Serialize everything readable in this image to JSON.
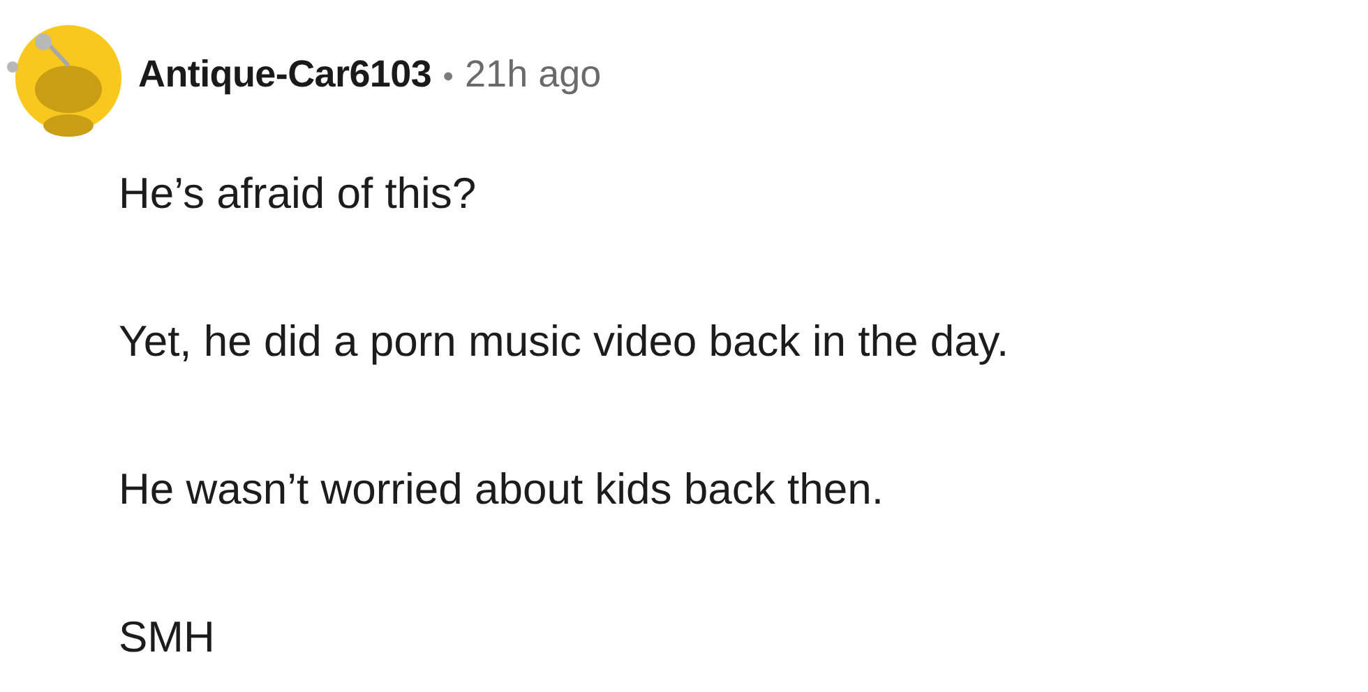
{
  "comment": {
    "author": "Antique-Car6103",
    "separator": "•",
    "time": "21h ago",
    "paragraphs": [
      "He’s afraid of this?",
      "Yet, he did a porn music video back in the day.",
      "He wasn’t worried about kids back then.",
      "SMH"
    ]
  }
}
